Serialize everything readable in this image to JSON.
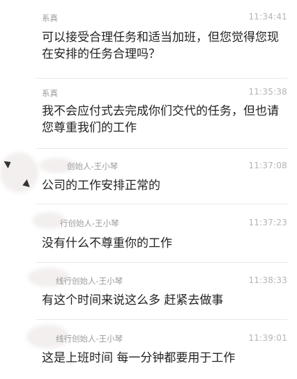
{
  "messages": [
    {
      "sender": "系真",
      "time": "11:34:41",
      "text": "可以接受合理任务和适当加班，但您觉得您现在安排的任务合理吗？"
    },
    {
      "sender": "系真",
      "time": "11:35:38",
      "text": "我不会应付式去完成你们交代的任务，但也请您尊重我们的工作"
    },
    {
      "sender": "创始人-王小琴",
      "time": "11:37:08",
      "text": "公司的工作安排正常的"
    },
    {
      "sender": "行创始人-王小琴",
      "time": "11:37:23",
      "text": "没有什么不尊重你的工作"
    },
    {
      "sender": "线行创始人-王小琴",
      "time": "11:38:33",
      "text": "有这个时间来说这么多 赶紧去做事"
    },
    {
      "sender": "线行创始人-王小琴",
      "time": "11:39:01",
      "text": "这是上班时间 每一分钟都要用于工作"
    }
  ]
}
